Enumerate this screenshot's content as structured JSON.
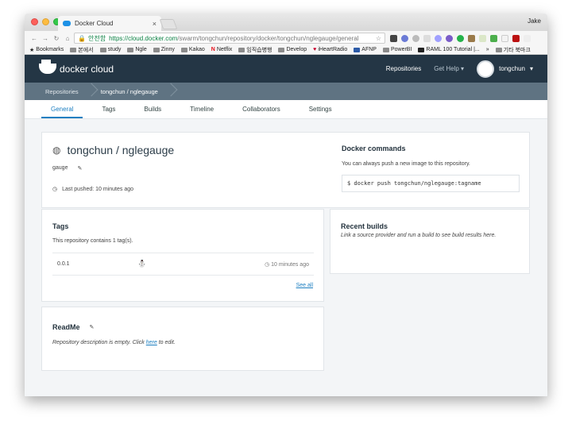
{
  "browser": {
    "tab_title": "Docker Cloud",
    "tab_close": "×",
    "user": "Jake",
    "security_label": "안전함",
    "url_host": "https://cloud.docker.com",
    "url_path": "/swarm/tongchun/repository/docker/tongchun/nglegauge/general",
    "bookmarks": [
      "Bookmarks",
      "본에서",
      "study",
      "Ngle",
      "Zinny",
      "Kakao",
      "Netflix",
      "임직습병행",
      "Develop",
      "iHeartRadio",
      "AFNP",
      "PowerBI",
      "RAML 100 Tutorial |...",
      "»",
      "기타 북마크"
    ]
  },
  "nav": {
    "logo_text": "docker cloud",
    "repositories": "Repositories",
    "get_help": "Get Help",
    "username": "tongchun"
  },
  "breadcrumb": {
    "root": "Repositories",
    "current": "tongchun / nglegauge"
  },
  "tabs": [
    "General",
    "Tags",
    "Builds",
    "Timeline",
    "Collaborators",
    "Settings"
  ],
  "repo": {
    "owner": "tongchun",
    "slash": "/",
    "name": "nglegauge",
    "short_desc": "gauge",
    "last_pushed": "Last pushed: 10 minutes ago"
  },
  "commands": {
    "title": "Docker commands",
    "subtitle": "You can always push a new image to this repository.",
    "command": "$ docker push tongchun/nglegauge:tagname"
  },
  "tags_card": {
    "title": "Tags",
    "summary": "This repository contains 1 tag(s).",
    "rows": [
      {
        "tag": "0.0.1",
        "time": "10 minutes ago"
      }
    ],
    "see_all": "See all"
  },
  "builds": {
    "title": "Recent builds",
    "message": "Link a source provider and run a build to see build results here."
  },
  "readme": {
    "title": "ReadMe",
    "text_before": "Repository description is empty. Click",
    "here": "here",
    "text_after": "to edit."
  },
  "colors": {
    "nav_bg": "#243645",
    "crumb_bg": "#5f7382",
    "accent": "#1d7fc1"
  }
}
